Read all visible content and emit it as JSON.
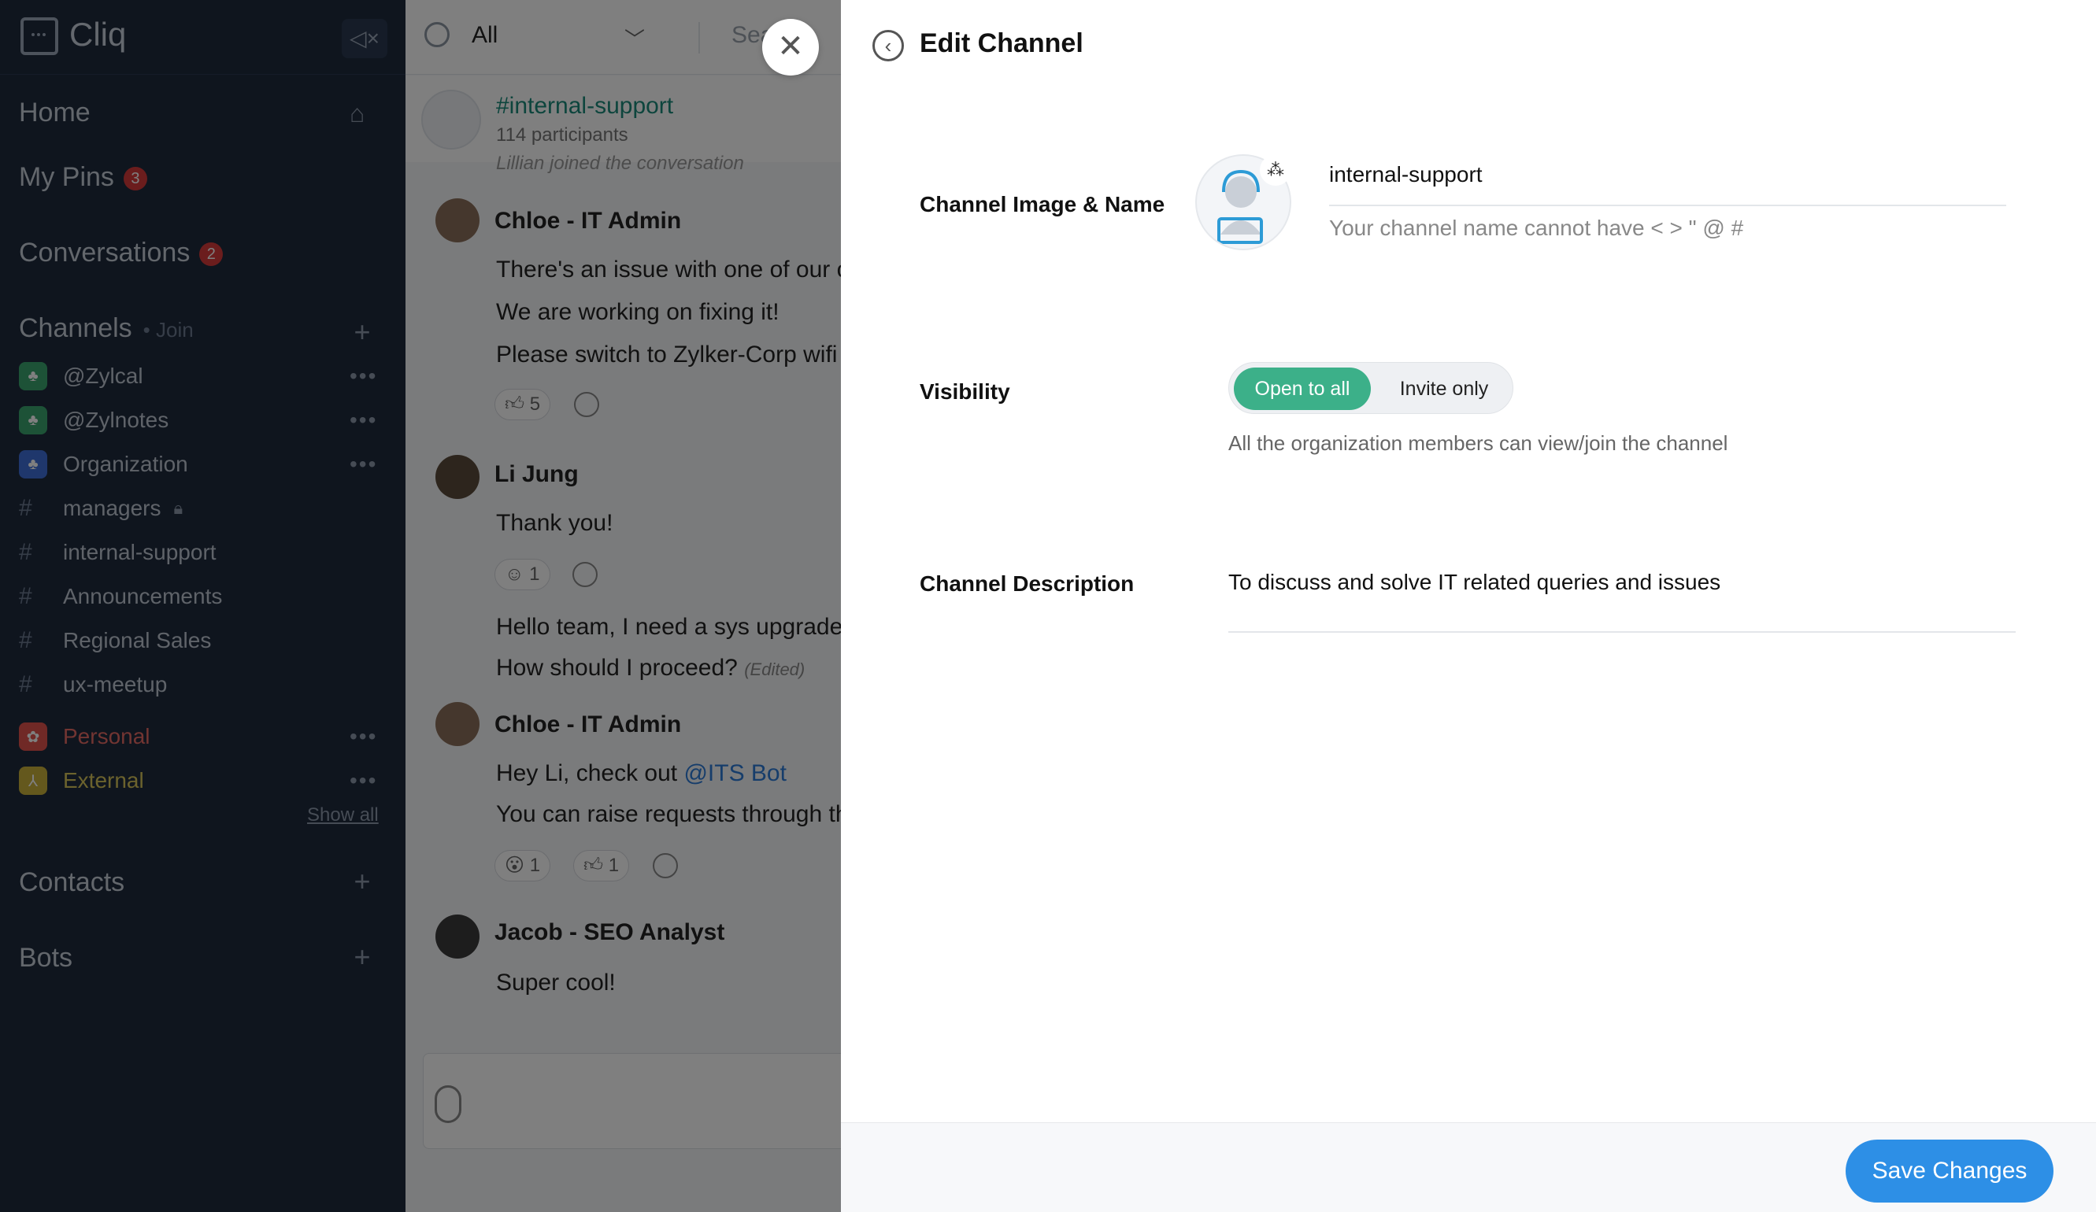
{
  "app": {
    "name": "Cliq"
  },
  "sidebar": {
    "home": "Home",
    "my_pins": "My Pins",
    "my_pins_count": "3",
    "conversations": "Conversations",
    "conversations_count": "2",
    "channels": "Channels",
    "join": "• Join",
    "channel_items": [
      {
        "label": "@Zylcal",
        "color": "#3aa56e",
        "icon": "org-icon"
      },
      {
        "label": "@Zylnotes",
        "color": "#3aa56e",
        "icon": "org-icon"
      },
      {
        "label": "Organization",
        "color": "#3f6fd8",
        "icon": "org-icon"
      },
      {
        "label": "managers",
        "icon": "hash-icon",
        "locked": true
      },
      {
        "label": "internal-support",
        "icon": "hash-icon"
      },
      {
        "label": "Announcements",
        "icon": "hash-icon"
      },
      {
        "label": "Regional Sales",
        "icon": "hash-icon"
      },
      {
        "label": "ux-meetup",
        "icon": "hash-icon"
      },
      {
        "label": "Personal",
        "color": "#e0524d",
        "icon": "people-icon"
      },
      {
        "label": "External",
        "color": "#c8b13a",
        "icon": "external-icon"
      }
    ],
    "show_all": "Show all",
    "contacts": "Contacts",
    "bots": "Bots"
  },
  "chat": {
    "filter": "All",
    "search_placeholder": "Search",
    "channel_name": "#internal-support",
    "participants": "114 participants",
    "joined_note": "Lillian joined the conversation",
    "messages": [
      {
        "author": "Chloe - IT Admin",
        "lines": [
          "There's an issue with one of our co",
          "We are working on fixing it!",
          "Please switch to Zylker-Corp wifi"
        ],
        "reaction": "5"
      },
      {
        "author": "Li Jung",
        "lines": [
          "Thank you!"
        ],
        "reaction": "1"
      },
      {
        "lines": [
          "Hello team, I need a sys upgrade.",
          "How should I proceed?"
        ],
        "edited": "(Edited)"
      },
      {
        "author": "Chloe - IT Admin",
        "lines": [
          "Hey Li, check out ",
          "You can raise requests through th"
        ],
        "mention": "@ITS Bot",
        "reactions": [
          "1",
          "1"
        ]
      },
      {
        "author": "Jacob - SEO Analyst",
        "lines": [
          "Super cool!"
        ]
      }
    ]
  },
  "panel": {
    "title": "Edit Channel",
    "image_name_label": "Channel Image & Name",
    "channel_name_value": "internal-support",
    "channel_name_hint": "Your channel name cannot have < > \" @ #",
    "visibility_label": "Visibility",
    "visibility_open": "Open to all",
    "visibility_invite": "Invite only",
    "visibility_selected": "Open to all",
    "visibility_hint": "All the organization members can view/join the channel",
    "description_label": "Channel Description",
    "description_value": "To discuss and solve IT related queries and issues",
    "save_button": "Save Changes"
  },
  "colors": {
    "sidebar_bg": "#1e2a3d",
    "accent_green": "#3cb089",
    "save_blue": "#2d8fe6",
    "channel_link": "#1a8a7a"
  }
}
